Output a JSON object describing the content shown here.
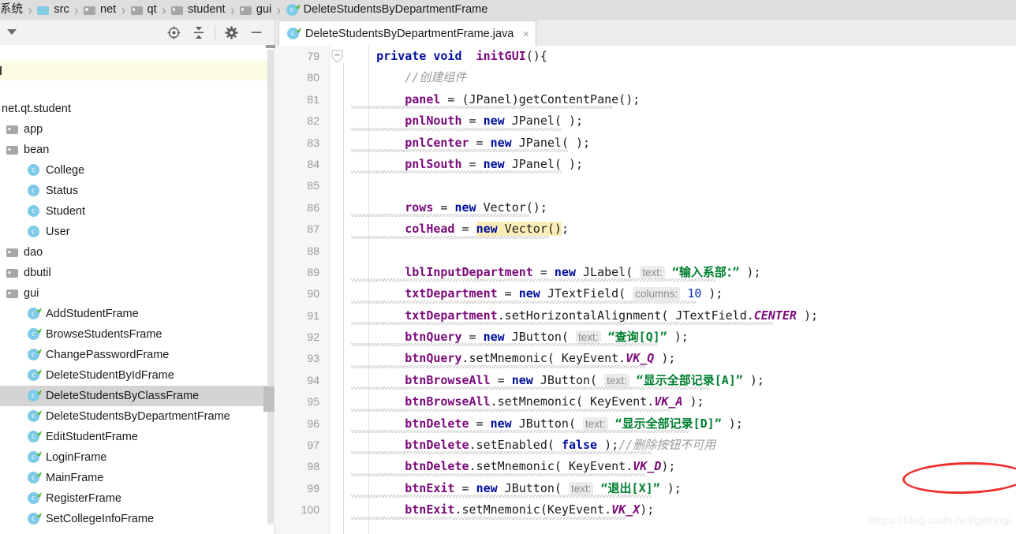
{
  "breadcrumb": {
    "items": [
      {
        "label": "系统",
        "icon": "none"
      },
      {
        "label": "src",
        "icon": "folder-src-icon"
      },
      {
        "label": "net",
        "icon": "folder-icon"
      },
      {
        "label": "qt",
        "icon": "folder-icon"
      },
      {
        "label": "student",
        "icon": "folder-icon"
      },
      {
        "label": "gui",
        "icon": "folder-icon"
      },
      {
        "label": "DeleteStudentsByDepartmentFrame",
        "icon": "java-class-icon"
      }
    ],
    "separator": "›"
  },
  "left_toolbar": {
    "caret": "caret-down-icon",
    "buttons": [
      {
        "name": "locate-icon",
        "title": "Select Opened File"
      },
      {
        "name": "collapse-all-icon",
        "title": "Collapse All"
      },
      {
        "name": "gear-icon",
        "title": "Settings"
      },
      {
        "name": "hide-icon",
        "title": "Hide"
      }
    ]
  },
  "tree": {
    "root": "net.qt.student",
    "items": [
      {
        "label": "net.qt.student",
        "icon": "package-icon",
        "level": 0,
        "selected": false
      },
      {
        "label": "app",
        "icon": "folder-icon",
        "level": 1,
        "selected": false
      },
      {
        "label": "bean",
        "icon": "folder-icon",
        "level": 1,
        "selected": false
      },
      {
        "label": "College",
        "icon": "class-icon",
        "level": 2,
        "selected": false
      },
      {
        "label": "Status",
        "icon": "class-icon",
        "level": 2,
        "selected": false
      },
      {
        "label": "Student",
        "icon": "class-icon",
        "level": 2,
        "selected": false
      },
      {
        "label": "User",
        "icon": "class-icon",
        "level": 2,
        "selected": false
      },
      {
        "label": "dao",
        "icon": "folder-icon",
        "level": 1,
        "selected": false
      },
      {
        "label": "dbutil",
        "icon": "folder-icon",
        "level": 1,
        "selected": false
      },
      {
        "label": "gui",
        "icon": "folder-icon",
        "level": 1,
        "selected": false
      },
      {
        "label": "AddStudentFrame",
        "icon": "java-class-icon",
        "level": 2,
        "selected": false
      },
      {
        "label": "BrowseStudentsFrame",
        "icon": "java-class-icon",
        "level": 2,
        "selected": false
      },
      {
        "label": "ChangePasswordFrame",
        "icon": "java-class-icon",
        "level": 2,
        "selected": false
      },
      {
        "label": "DeleteStudentByIdFrame",
        "icon": "java-class-icon",
        "level": 2,
        "selected": false
      },
      {
        "label": "DeleteStudentsByClassFrame",
        "icon": "java-class-icon",
        "level": 2,
        "selected": true
      },
      {
        "label": "DeleteStudentsByDepartmentFrame",
        "icon": "java-class-icon",
        "level": 2,
        "selected": false
      },
      {
        "label": "EditStudentFrame",
        "icon": "java-class-icon",
        "level": 2,
        "selected": false
      },
      {
        "label": "LoginFrame",
        "icon": "java-class-icon",
        "level": 2,
        "selected": false
      },
      {
        "label": "MainFrame",
        "icon": "java-class-icon",
        "level": 2,
        "selected": false
      },
      {
        "label": "RegisterFrame",
        "icon": "java-class-icon",
        "level": 2,
        "selected": false
      },
      {
        "label": "SetCollegeInfoFrame",
        "icon": "java-class-icon",
        "level": 2,
        "selected": false
      }
    ]
  },
  "editor": {
    "tab": {
      "label": "DeleteStudentsByDepartmentFrame.java",
      "icon": "java-class-icon",
      "close": "×"
    },
    "first_line": 79,
    "lines": [
      {
        "n": "79",
        "text": "    private void  initGUI(){"
      },
      {
        "n": "80",
        "text": "        //创建组件"
      },
      {
        "n": "81",
        "text": "        panel = (JPanel)getContentPane();"
      },
      {
        "n": "82",
        "text": "        pnlNouth = new JPanel( );"
      },
      {
        "n": "83",
        "text": "        pnlCenter = new JPanel( );"
      },
      {
        "n": "84",
        "text": "        pnlSouth = new JPanel( );"
      },
      {
        "n": "85",
        "text": ""
      },
      {
        "n": "86",
        "text": "        rows = new Vector();"
      },
      {
        "n": "87",
        "text": "        colHead = new Vector();"
      },
      {
        "n": "88",
        "text": ""
      },
      {
        "n": "89",
        "text": "        lblInputDepartment = new JLabel( text: “输入系部：” );"
      },
      {
        "n": "90",
        "text": "        txtDepartment = new JTextField( columns: 10 );"
      },
      {
        "n": "91",
        "text": "        txtDepartment.setHorizontalAlignment( JTextField.CENTER );"
      },
      {
        "n": "92",
        "text": "        btnQuery = new JButton( text: “查询[Q]” );"
      },
      {
        "n": "93",
        "text": "        btnQuery.setMnemonic( KeyEvent.VK_Q );"
      },
      {
        "n": "94",
        "text": "        btnBrowseAll = new JButton( text: “显示全部记录[A]” );"
      },
      {
        "n": "95",
        "text": "        btnBrowseAll.setMnemonic( KeyEvent.VK_A );"
      },
      {
        "n": "96",
        "text": "        btnDelete = new JButton( text: “显示全部记录[D]” );"
      },
      {
        "n": "97",
        "text": "        btnDelete.setEnabled( false );//删除按钮不可用"
      },
      {
        "n": "98",
        "text": "        btnDelete.setMnemonic( KeyEvent.VK_D);"
      },
      {
        "n": "99",
        "text": "        btnExit = new JButton( text: “退出[X]” );"
      },
      {
        "n": "100",
        "text": "        btnExit.setMnemonic(KeyEvent.VK_X);"
      }
    ],
    "inline_hints": [
      "text:",
      "columns:"
    ],
    "highlighted_token": "new Vector()",
    "annotation": {
      "shape": "red-ellipse",
      "target": "显示全部记录[D]",
      "color": "#ee2f2f"
    }
  },
  "watermark": "https://blog.csdn.net/gettingi",
  "colors": {
    "keyword": "#000f9c",
    "field": "#7a0a7a",
    "string": "#007f2e",
    "number": "#0033b3",
    "comment": "#9a9a9a",
    "hint_bg": "#ebebeb",
    "highlight_bg": "#fbedb8",
    "selection_bg": "#d4d4d4",
    "annotation": "#ee2f2f"
  }
}
